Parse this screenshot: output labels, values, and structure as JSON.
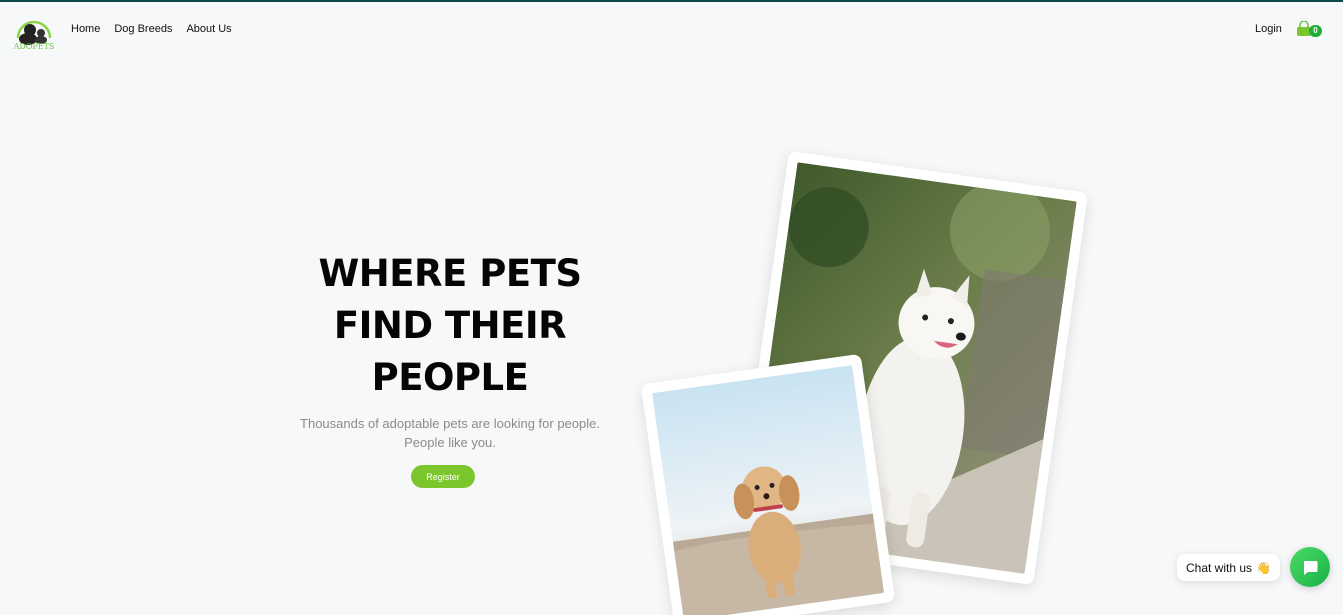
{
  "brand": {
    "logo_text": "ADOPETS",
    "accent": "#7cc62d"
  },
  "nav": {
    "items": [
      {
        "label": "Home"
      },
      {
        "label": "Dog Breeds"
      },
      {
        "label": "About Us"
      }
    ]
  },
  "header": {
    "login_label": "Login",
    "cart_count": "0",
    "cart_icon": "shopping-bag-icon"
  },
  "hero": {
    "title": "WHERE PETS\nFIND THEIR\nPEOPLE",
    "subtitle": "Thousands of adoptable pets are looking for people.\nPeople like you.",
    "cta_label": "Register"
  },
  "photos": [
    {
      "name": "white-samoyed-photo"
    },
    {
      "name": "cocker-spaniel-puppy-photo"
    }
  ],
  "chat": {
    "label": "Chat with us",
    "emoji": "👋",
    "icon": "chat-icon"
  }
}
